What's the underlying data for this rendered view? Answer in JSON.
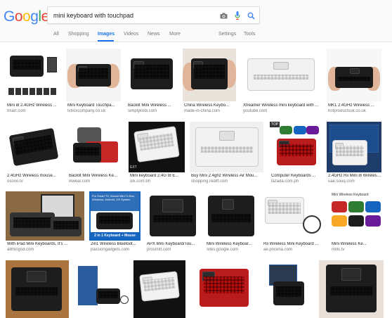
{
  "header": {
    "logo_letters": [
      "G",
      "o",
      "o",
      "g",
      "l",
      "e"
    ],
    "logo_colors": [
      "#4285f4",
      "#ea4335",
      "#fbbc05",
      "#4285f4",
      "#34a853",
      "#ea4335"
    ],
    "search_value": "mini keyboard with touchpad",
    "camera_icon": "camera-icon",
    "mic_icon": "mic-icon",
    "search_icon": "search-icon"
  },
  "tabs": {
    "all": "All",
    "shopping": "Shopping",
    "images": "Images",
    "videos": "Videos",
    "news": "News",
    "more": "More",
    "settings": "Settings",
    "tools": "Tools"
  },
  "accent": "#1a73e8",
  "results": {
    "row1": [
      {
        "caption": "Mini i8 2.4GHz Wireless ...",
        "source": "tmart.com"
      },
      {
        "caption": "Mini Keyboard Touchpa...",
        "source": "tvboxcompany.co.uk"
      },
      {
        "caption": "Backlit Mini Wireless ...",
        "source": "simplykodi.com"
      },
      {
        "caption": "China Wireless Keybo...",
        "source": "made-in-china.com"
      },
      {
        "caption": "Xtreamer Wireless mini keyboard with ...",
        "source": "youtube.com"
      },
      {
        "caption": "MK1 2.4GHz Wireless ...",
        "source": "hotproductsuk.co.uk"
      }
    ],
    "row2": [
      {
        "caption": "2.4GHz Wireless mouse...",
        "source": "osorio.tv"
      },
      {
        "caption": "Backlit Mini Wireless Ke...",
        "source": "ikwear.com"
      },
      {
        "caption": "Mini keyboard 2.4G I8 E...",
        "source": "olx.com.bh"
      },
      {
        "caption": "Buy Mini 2.4ghz Wireless Air Mou...",
        "source": "shopping.rediff.com"
      },
      {
        "caption": "Computer Keyboards ...",
        "source": "lazada.com.ph"
      },
      {
        "caption": "2.4GHz Rii Mini i8 Wireless K...",
        "source": "uae.souq.com"
      }
    ],
    "row3": [
      {
        "caption": "With iPad Mini Keyboards, It's ...",
        "source": "allthingsd.com"
      },
      {
        "caption": "2in1 Wireless Bluetoot...",
        "source": "passiongadgets.com"
      },
      {
        "caption": "APX Mini Keyboard/Tou...",
        "source": "prosmitt.com"
      },
      {
        "caption": "Mini Wireless Keyboar...",
        "source": "sites.google.com"
      },
      {
        "caption": "Rii Wireless Mini Keyboard ...",
        "source": "ae.pricena.com"
      },
      {
        "caption": "Mini Wireless Ke...",
        "source": "mills.tv"
      }
    ],
    "row2_badges": {
      "ext": "EXT",
      "top": "TOP"
    },
    "banner_text": "For Smart TV, Xiaomi Mini Tv Box, Windows, Android, OS System",
    "banner_bottom": "2 in 1 Keyboard + Mouse",
    "mini_kb_label": "Mini Wireless Keyboard"
  }
}
